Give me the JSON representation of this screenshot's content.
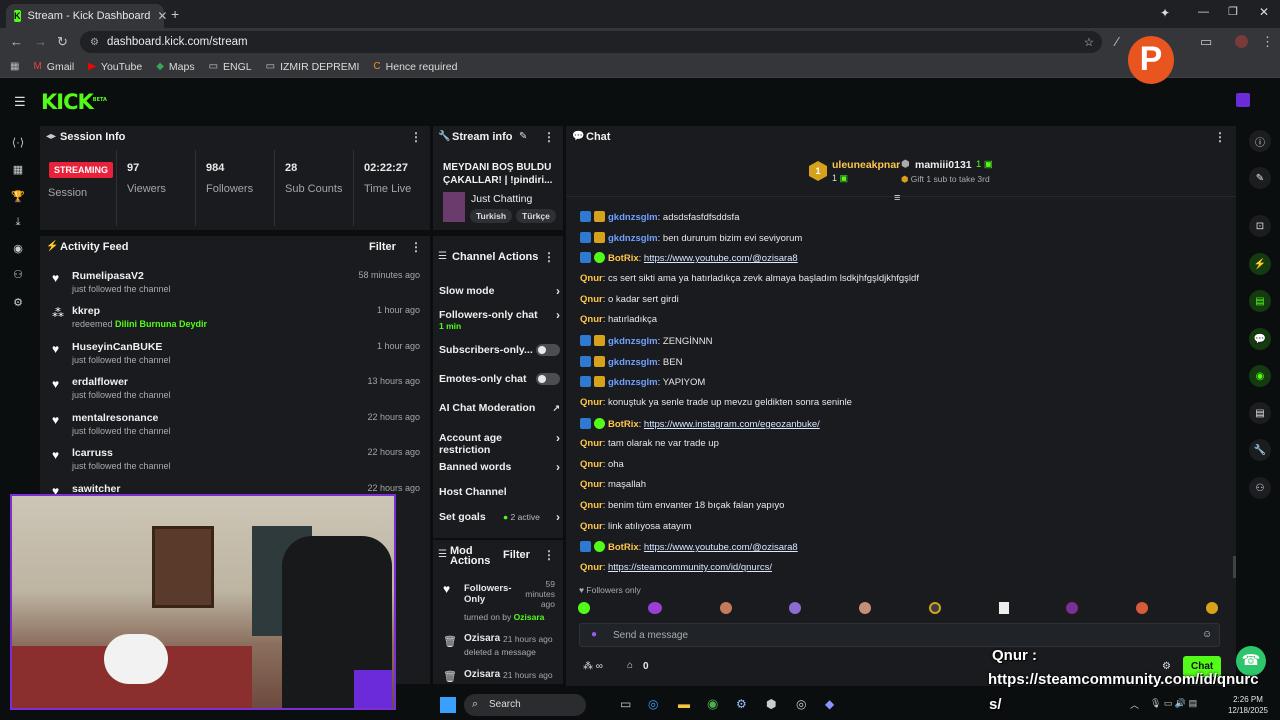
{
  "browser": {
    "tab_title": "Stream - Kick Dashboard",
    "url": "dashboard.kick.com/stream",
    "bookmarks": [
      "Gmail",
      "YouTube",
      "Maps",
      "ENGL",
      "IZMIR DEPREMI",
      "Hence required"
    ]
  },
  "header": {
    "logo": "KICK",
    "logo_badge": "BETA"
  },
  "session": {
    "title": "Session Info",
    "status": "STREAMING",
    "status_label": "Session",
    "stats": [
      {
        "value": "97",
        "label": "Viewers"
      },
      {
        "value": "984",
        "label": "Followers"
      },
      {
        "value": "28",
        "label": "Sub Counts"
      },
      {
        "value": "02:22:27",
        "label": "Time Live"
      }
    ]
  },
  "stream_info": {
    "title": "Stream info",
    "stream_title": "MEYDANI BOŞ BULDU ÇAKALLAR! | !pindiri...",
    "category": "Just Chatting",
    "tags": [
      "Turkish",
      "Türkçe"
    ]
  },
  "activity": {
    "title": "Activity Feed",
    "filter": "Filter",
    "items": [
      {
        "name": "RumelipasaV2",
        "sub": "just followed the channel",
        "time": "58 minutes ago",
        "icon": "heart-icon"
      },
      {
        "name": "kkrep",
        "sub": "redeemed",
        "sub_highlight": "Dilini Burnuna Deydir",
        "time": "1 hour ago",
        "icon": "points-icon"
      },
      {
        "name": "HuseyinCanBUKE",
        "sub": "just followed the channel",
        "time": "1 hour ago",
        "icon": "heart-icon"
      },
      {
        "name": "erdalflower",
        "sub": "just followed the channel",
        "time": "13 hours ago",
        "icon": "heart-icon"
      },
      {
        "name": "mentalresonance",
        "sub": "just followed the channel",
        "time": "22 hours ago",
        "icon": "heart-icon"
      },
      {
        "name": "lcarruss",
        "sub": "just followed the channel",
        "time": "22 hours ago",
        "icon": "heart-icon"
      },
      {
        "name": "sawitcher",
        "sub": "",
        "time": "22 hours ago",
        "icon": "heart-icon"
      }
    ]
  },
  "channel_actions": {
    "title": "Channel Actions",
    "items": [
      {
        "label": "Slow mode",
        "control": "chevron"
      },
      {
        "label": "Followers-only chat",
        "sub": "1 min",
        "control": "chevron"
      },
      {
        "label": "Subscribers-only...",
        "control": "toggle"
      },
      {
        "label": "Emotes-only chat",
        "control": "toggle"
      },
      {
        "label": "AI Chat Moderation",
        "control": "external"
      },
      {
        "label": "Account age restriction",
        "control": "chevron"
      },
      {
        "label": "Banned words",
        "control": "chevron"
      },
      {
        "label": "Host Channel",
        "control": "none"
      },
      {
        "label": "Set goals",
        "badge": "2 active",
        "control": "chevron"
      }
    ]
  },
  "mod_actions": {
    "title": "Mod Actions",
    "filter": "Filter",
    "items": [
      {
        "title": "Followers-Only",
        "time": "59 minutes ago",
        "sub": "turned on by",
        "by": "Ozisara"
      },
      {
        "title": "Ozisara",
        "time": "21 hours ago",
        "sub": "deleted a message"
      },
      {
        "title": "Ozisara",
        "time": "21 hours ago",
        "sub": ""
      }
    ]
  },
  "chat": {
    "title": "Chat",
    "leaders": [
      {
        "rank": "1",
        "name": "uleuneakpnar",
        "count": "1"
      },
      {
        "name": "mamiii0131",
        "count": "1",
        "sub": "Gift 1 sub to take 3rd"
      }
    ],
    "messages": [
      {
        "user": "gkdnzsglm",
        "badges": [
          "mod",
          "crown"
        ],
        "color": "#6ea2ff",
        "text": "adsdsfasfdfsddsfa"
      },
      {
        "user": "gkdnzsglm",
        "badges": [
          "mod",
          "crown"
        ],
        "color": "#6ea2ff",
        "text": "ben dururum bizim evi seviyorum"
      },
      {
        "user": "BotRix",
        "badges": [
          "mod",
          "bot"
        ],
        "color": "#ffc64b",
        "link": "https://www.youtube.com/@ozisara8"
      },
      {
        "user": "Qnur",
        "badges": [],
        "color": "#ffc64b",
        "text": "cs sert sikti ama ya hatırladıkça zevk almaya başladım lsdkjhfgşldjkhfgşldf"
      },
      {
        "user": "Qnur",
        "badges": [],
        "color": "#ffc64b",
        "text": "o kadar sert girdi"
      },
      {
        "user": "Qnur",
        "badges": [],
        "color": "#ffc64b",
        "text": "hatırladıkça"
      },
      {
        "user": "gkdnzsglm",
        "badges": [
          "mod",
          "crown"
        ],
        "color": "#6ea2ff",
        "text": "ZENGİNNN"
      },
      {
        "user": "gkdnzsglm",
        "badges": [
          "mod",
          "crown"
        ],
        "color": "#6ea2ff",
        "text": "BEN"
      },
      {
        "user": "gkdnzsglm",
        "badges": [
          "mod",
          "crown"
        ],
        "color": "#6ea2ff",
        "text": "YAPIYOM"
      },
      {
        "user": "Qnur",
        "badges": [],
        "color": "#ffc64b",
        "text": "konuştuk ya senle trade up mevzu geldikten sonra seninle"
      },
      {
        "user": "BotRix",
        "badges": [
          "mod",
          "bot"
        ],
        "color": "#ffc64b",
        "link": "https://www.instagram.com/egeozanbuke/"
      },
      {
        "user": "Qnur",
        "badges": [],
        "color": "#ffc64b",
        "text": "tam olarak ne var trade up"
      },
      {
        "user": "Qnur",
        "badges": [],
        "color": "#ffc64b",
        "text": "oha"
      },
      {
        "user": "Qnur",
        "badges": [],
        "color": "#ffc64b",
        "text": "maşallah"
      },
      {
        "user": "Qnur",
        "badges": [],
        "color": "#ffc64b",
        "text": "benim tüm envanter 18 bıçak falan yapıyo"
      },
      {
        "user": "Qnur",
        "badges": [],
        "color": "#ffc64b",
        "text": "link atılıyosa atayım"
      },
      {
        "user": "BotRix",
        "badges": [
          "mod",
          "bot"
        ],
        "color": "#ffc64b",
        "link": "https://www.youtube.com/@ozisara8"
      },
      {
        "user": "Qnur",
        "badges": [],
        "color": "#ffc64b",
        "link": "https://steamcommunity.com/id/qnurcs/"
      }
    ],
    "mode": "Followers only",
    "placeholder": "Send a message",
    "points": "0",
    "send_label": "Chat"
  },
  "overlay": {
    "line1": "Qnur :",
    "line2": "https://steamcommunity.com/id/qnurc",
    "line3": "s/"
  },
  "taskbar": {
    "search": "Search",
    "time": "2:26 PM",
    "date": "12/18/2025"
  },
  "colors": {
    "accent": "#53fc18",
    "live": "#e8223b",
    "panel": "#191b1f"
  }
}
